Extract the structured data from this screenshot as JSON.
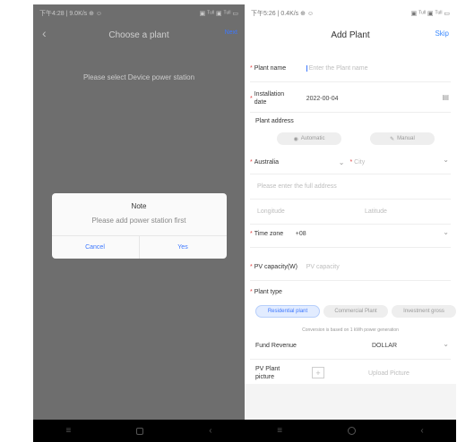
{
  "left": {
    "status": {
      "left": "下午4:28 | 9.0K/s ⊕ ☺",
      "right": "▣ ᵀᵘˡˡ ▣ ᵀᵘˡˡ ▭"
    },
    "nav": {
      "back": "‹",
      "title": "Choose a plant",
      "action": "Next"
    },
    "prompt": "Please select Device power station",
    "dialog": {
      "title": "Note",
      "message": "Please add power station first",
      "cancel": "Cancel",
      "confirm": "Yes"
    }
  },
  "right": {
    "status": {
      "left": "下午5:26 | 0.4K/s ⊕ ☺",
      "right": "▣ ᵀᵘˡˡ ▣ ᵀᵘˡˡ ▭"
    },
    "nav": {
      "title": "Add Plant",
      "action": "Skip"
    },
    "form": {
      "plant_name_label": "Plant name",
      "plant_name_placeholder": "Enter the Plant name",
      "install_label_1": "Installation",
      "install_label_2": "date",
      "install_value": "2022-00-04",
      "address_label": "Plant address",
      "automatic": "Automatic",
      "manual": "Manual",
      "country": "Australia",
      "city": "City",
      "full_address_placeholder": "Please enter the full address",
      "longitude": "Longitude",
      "latitude": "Latitude",
      "timezone_label": "Time zone",
      "timezone_value": "+08",
      "pv_capacity_label": "PV capacity(W)",
      "pv_capacity_placeholder": "PV capacity",
      "plant_type_label": "Plant type",
      "type_residential": "Residential plant",
      "type_commercial": "Commercial Plant",
      "type_investment": "Investment gross",
      "type_note": "Conversion is based on 1 kWh power generation",
      "fund_label": "Fund Revenue",
      "fund_value": "DOLLAR",
      "picture_label_1": "PV Plant",
      "picture_label_2": "picture",
      "upload": "Upload Picture"
    }
  },
  "colors": {
    "accent": "#3d78ff",
    "required": "#e04040",
    "overlay": "#6e6e6e"
  }
}
